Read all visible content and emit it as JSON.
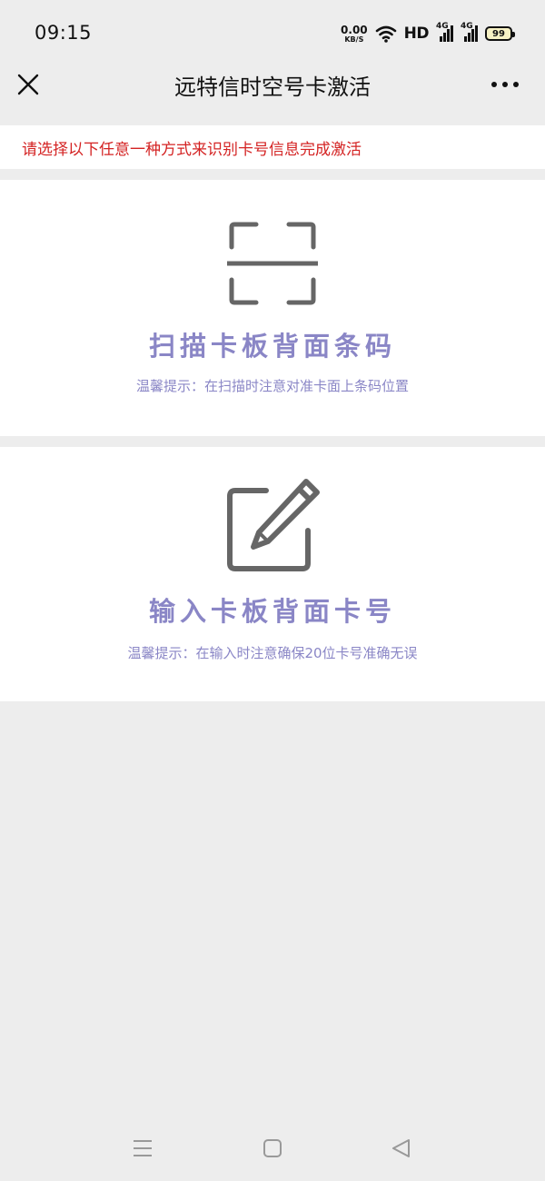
{
  "status_bar": {
    "time": "09:15",
    "net_speed_value": "0.00",
    "net_speed_unit": "KB/S",
    "hd_label": "HD",
    "signal_1_tag": "4G",
    "signal_2_tag": "4G",
    "battery_level": "99"
  },
  "header": {
    "title": "远特信时空号卡激活",
    "close_icon": "close-icon",
    "more_icon": "more-dots-icon"
  },
  "notice": {
    "text": "请选择以下任意一种方式来识别卡号信息完成激活",
    "color": "#d42323"
  },
  "options": [
    {
      "icon": "scan-barcode-icon",
      "title": "扫描卡板背面条码",
      "tip": "温馨提示：在扫描时注意对准卡面上条码位置"
    },
    {
      "icon": "edit-icon",
      "title": "输入卡板背面卡号",
      "tip": "温馨提示：在输入时注意确保20位卡号准确无误"
    }
  ],
  "theme": {
    "accent": "#8a86c6",
    "background": "#ededed",
    "icon_color": "#666666"
  },
  "nav": {
    "menu_icon": "menu-icon",
    "home_icon": "home-square-icon",
    "back_icon": "back-triangle-icon"
  }
}
